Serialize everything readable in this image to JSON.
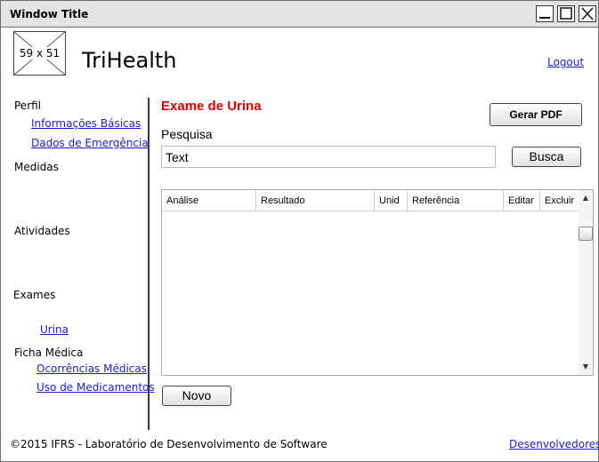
{
  "window": {
    "title": "Window Title"
  },
  "header": {
    "logo_label": "59 x 51",
    "app_name": "TriHealth",
    "logout_label": "Logout"
  },
  "sidebar": {
    "perfil": {
      "label": "Perfil",
      "items": [
        "Informações Básicas",
        "Dados de Emergência"
      ]
    },
    "medidas": {
      "label": "Medidas"
    },
    "atividades": {
      "label": "Atividades"
    },
    "exames": {
      "label": "Exames",
      "items": [
        "Urina"
      ]
    },
    "ficha": {
      "label": "Ficha Médica",
      "items": [
        "Ocorrências Médicas",
        "Uso de Medicamentos"
      ]
    }
  },
  "main": {
    "title": "Exame de Urina",
    "pdf_button": "Gerar PDF",
    "search_label": "Pesquisa",
    "search_placeholder": "Text",
    "search_button": "Busca",
    "table_columns": [
      "Análise",
      "Resultado",
      "Unid",
      "Referência",
      "Editar",
      "Excluir"
    ],
    "table_rows": [],
    "new_button": "Novo"
  },
  "footer": {
    "copyright": "©2015 IFRS - Laboratório de Desenvolvimento de Software",
    "devs_link": "Desenvolvedores"
  },
  "colors": {
    "title_red": "#e00000",
    "link_blue": "#1a1ad4"
  }
}
